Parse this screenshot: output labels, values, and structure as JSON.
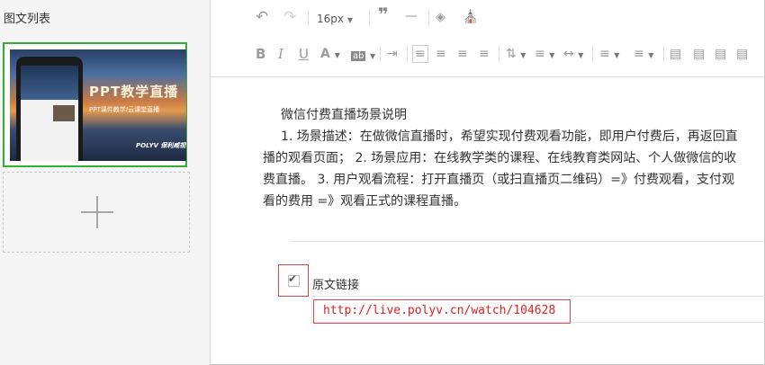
{
  "sidebar": {
    "title": "图文列表",
    "thumbnail": {
      "heading": "PPT教学直播",
      "subheading": "PPT课件教学/云课堂直播",
      "logo": "POLYV 保利威视"
    },
    "add_icon": "plus-icon"
  },
  "toolbar": {
    "font_size": "16px",
    "icons_row1": [
      "undo-icon",
      "redo-icon",
      "quote-icon",
      "horizontal-rule-icon",
      "clear-format-icon",
      "format-painter-icon"
    ],
    "icons_row2": [
      "bold-icon",
      "italic-icon",
      "underline-icon",
      "font-color-icon",
      "background-color-icon",
      "indent-icon",
      "align-left-icon",
      "align-center-icon",
      "align-right-icon",
      "justify-icon",
      "line-height-icon",
      "paragraph-spacing-icon",
      "letter-spacing-icon",
      "ordered-list-icon",
      "unordered-list-icon",
      "float-left-icon",
      "float-none-icon",
      "float-right-icon",
      "float-center-icon"
    ],
    "labels": {
      "bold": "B",
      "italic": "I",
      "underline": "U",
      "font_color": "A",
      "background_color": "ab"
    }
  },
  "editor": {
    "title": "微信付费直播场景说明",
    "body": "1. 场景描述：在做微信直播时，希望实现付费观看功能，即用户付费后，再返回直播的观看页面； 2. 场景应用：在线教学类的课程、在线教育类网站、个人做微信的收费直播。 3. 用户观看流程：打开直播页（或扫直播页二维码）=》付费观看，支付观看的费用 =》观看正式的课程直播。"
  },
  "source_link": {
    "label": "原文链接",
    "checked": true,
    "url": "http://live.polyv.cn/watch/104628"
  },
  "colors": {
    "selected_border": "#2fb32f",
    "highlight_red": "#e24646",
    "url_text": "#e02020"
  }
}
